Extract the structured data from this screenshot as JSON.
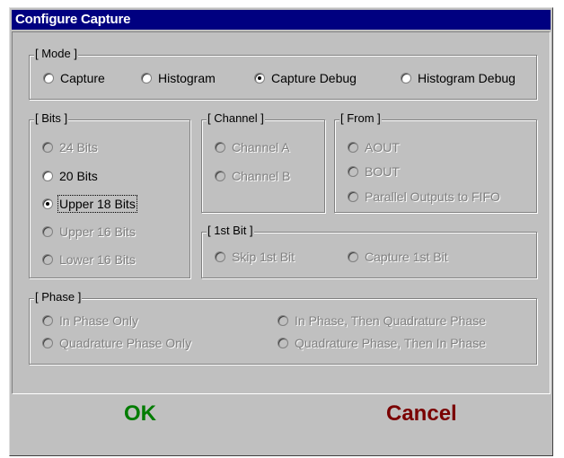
{
  "window": {
    "title": "Configure Capture"
  },
  "mode": {
    "legend": "[ Mode ]",
    "options": [
      {
        "label": "Capture",
        "selected": false,
        "enabled": true
      },
      {
        "label": "Histogram",
        "selected": false,
        "enabled": true
      },
      {
        "label": "Capture Debug",
        "selected": true,
        "enabled": true
      },
      {
        "label": "Histogram Debug",
        "selected": false,
        "enabled": true
      }
    ]
  },
  "bits": {
    "legend": "[ Bits ]",
    "options": [
      {
        "label": "24 Bits",
        "selected": false,
        "enabled": false
      },
      {
        "label": "20 Bits",
        "selected": false,
        "enabled": true
      },
      {
        "label": "Upper 18 Bits",
        "selected": true,
        "enabled": true,
        "focused": true
      },
      {
        "label": "Upper 16 Bits",
        "selected": false,
        "enabled": false
      },
      {
        "label": "Lower 16 Bits",
        "selected": false,
        "enabled": false
      }
    ]
  },
  "channel": {
    "legend": "[ Channel ]",
    "options": [
      {
        "label": "Channel A",
        "selected": false,
        "enabled": false
      },
      {
        "label": "Channel B",
        "selected": false,
        "enabled": false
      }
    ]
  },
  "from": {
    "legend": "[ From ]",
    "options": [
      {
        "label": "AOUT",
        "selected": false,
        "enabled": false
      },
      {
        "label": "BOUT",
        "selected": false,
        "enabled": false
      },
      {
        "label": "Parallel Outputs to FIFO",
        "selected": false,
        "enabled": false
      }
    ]
  },
  "first_bit": {
    "legend": "[ 1st Bit ]",
    "options": [
      {
        "label": "Skip 1st Bit",
        "selected": false,
        "enabled": false
      },
      {
        "label": "Capture 1st Bit",
        "selected": false,
        "enabled": false
      }
    ]
  },
  "phase": {
    "legend": "[ Phase ]",
    "options": [
      {
        "label": "In Phase Only",
        "selected": false,
        "enabled": false
      },
      {
        "label": "Quadrature Phase Only",
        "selected": false,
        "enabled": false
      },
      {
        "label": "In Phase, Then Quadrature Phase",
        "selected": false,
        "enabled": false
      },
      {
        "label": "Quadrature Phase, Then In Phase",
        "selected": false,
        "enabled": false
      }
    ]
  },
  "buttons": {
    "ok_label": "OK",
    "cancel_label": "Cancel"
  },
  "colors": {
    "title_bar": "#000080",
    "face": "#c0c0c0",
    "ok_text": "#007c00",
    "cancel_text": "#7a0000"
  }
}
